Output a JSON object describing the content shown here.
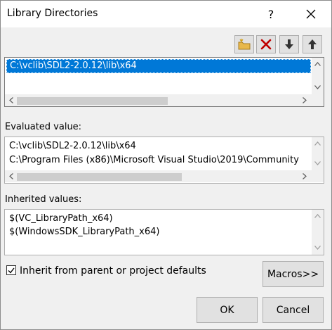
{
  "window": {
    "title": "Library Directories",
    "help_label": "?"
  },
  "toolbar": {
    "new_line_icon": "folder-new-icon",
    "delete_icon": "delete-x-icon",
    "move_down_icon": "arrow-down-icon",
    "move_up_icon": "arrow-up-icon"
  },
  "directories": {
    "items": [
      "C:\\vclib\\SDL2-2.0.12\\lib\\x64"
    ]
  },
  "evaluated": {
    "label": "Evaluated value:",
    "lines": [
      "C:\\vclib\\SDL2-2.0.12\\lib\\x64",
      "C:\\Program Files (x86)\\Microsoft Visual Studio\\2019\\Community"
    ]
  },
  "inherited": {
    "label": "Inherited values:",
    "lines": [
      "$(VC_LibraryPath_x64)",
      "$(WindowsSDK_LibraryPath_x64)"
    ]
  },
  "inherit_checkbox": {
    "label": "Inherit from parent or project defaults",
    "checked": true
  },
  "buttons": {
    "macros": "Macros>>",
    "ok": "OK",
    "cancel": "Cancel"
  },
  "colors": {
    "accent": "#0078d7",
    "delete_red": "#c00000",
    "folder_yellow": "#e8b84a"
  }
}
